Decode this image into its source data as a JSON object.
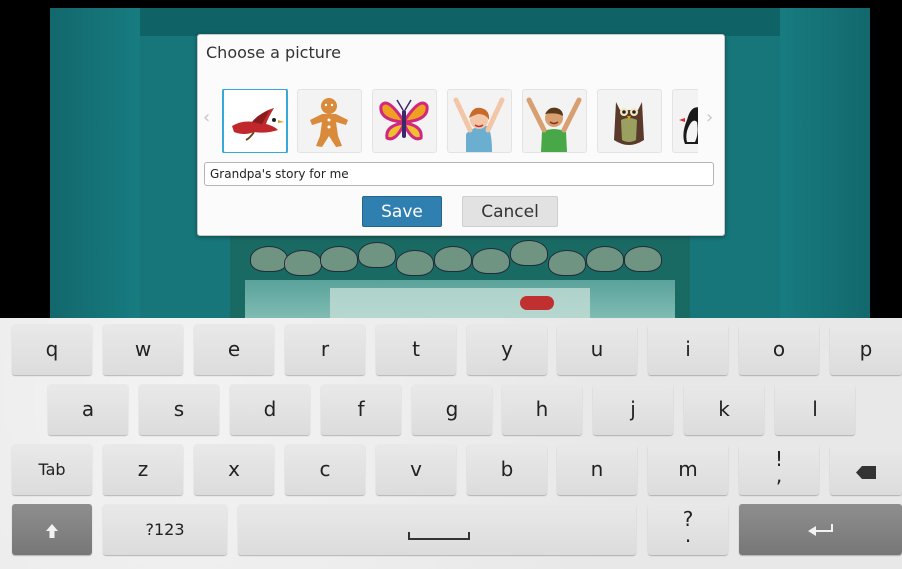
{
  "dialog": {
    "title": "Choose a picture",
    "prev_arrow": "‹",
    "next_arrow": "›",
    "pictures": [
      {
        "name": "red bird",
        "selected": true
      },
      {
        "name": "gingerbread man",
        "selected": false
      },
      {
        "name": "butterfly",
        "selected": false
      },
      {
        "name": "girl",
        "selected": false
      },
      {
        "name": "boy",
        "selected": false
      },
      {
        "name": "owl",
        "selected": false
      },
      {
        "name": "penguin",
        "selected": false
      }
    ],
    "name_value": "Grandpa's story for me",
    "save_label": "Save",
    "cancel_label": "Cancel",
    "accent_color": "#2f7fb0",
    "selection_color": "#38a8d8"
  },
  "keyboard": {
    "row1": [
      "q",
      "w",
      "e",
      "r",
      "t",
      "y",
      "u",
      "i",
      "o",
      "p"
    ],
    "row2": [
      "a",
      "s",
      "d",
      "f",
      "g",
      "h",
      "j",
      "k",
      "l"
    ],
    "row3": [
      "z",
      "x",
      "c",
      "v",
      "b",
      "n",
      "m"
    ],
    "tab_label": "Tab",
    "symbols_label": "?123",
    "punct1_top": "!",
    "punct1_bottom": ",",
    "punct2_top": "?",
    "punct2_bottom": ".",
    "icons": {
      "shift": "shift-icon",
      "delete": "backspace-icon",
      "space": "space-icon",
      "enter": "enter-icon"
    }
  },
  "scene": {
    "background_color": "#16767a"
  }
}
